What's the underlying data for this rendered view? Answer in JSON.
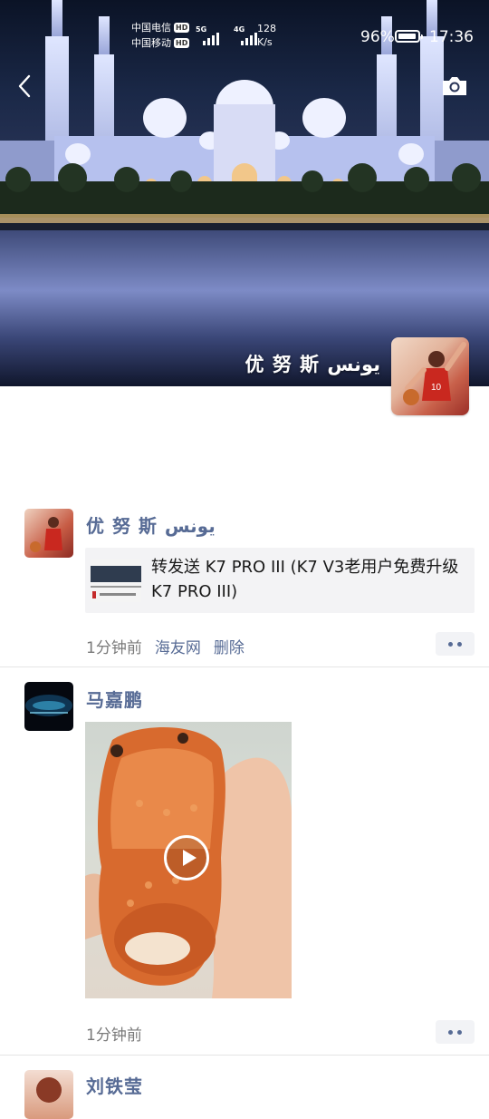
{
  "status_bar": {
    "carrier1": "中国电信",
    "carrier2": "中国移动",
    "hd_badge": "HD",
    "signal1_tag": "5G",
    "signal2_tag": "4G",
    "speed_value": "128",
    "speed_unit": "K/s",
    "battery_percent": "96%",
    "battery_level": 0.96,
    "time": "17:36"
  },
  "header": {
    "back_icon": "chevron-left-icon",
    "camera_icon": "camera-icon",
    "profile_name": "优 努 斯  يونس"
  },
  "posts": [
    {
      "author": "优 努 斯  يونس",
      "share_text": "转发送 K7 PRO III (K7 V3老用户免费升级K7 PRO III)",
      "time": "1分钟前",
      "source": "海友网",
      "delete_label": "删除"
    },
    {
      "author": "马嘉鹏",
      "time": "1分钟前",
      "media": "video"
    },
    {
      "author": "刘铁莹"
    }
  ],
  "colors": {
    "link_blue": "#576b95",
    "meta_gray": "#7a7a7a",
    "divider": "#e5e5e5"
  }
}
